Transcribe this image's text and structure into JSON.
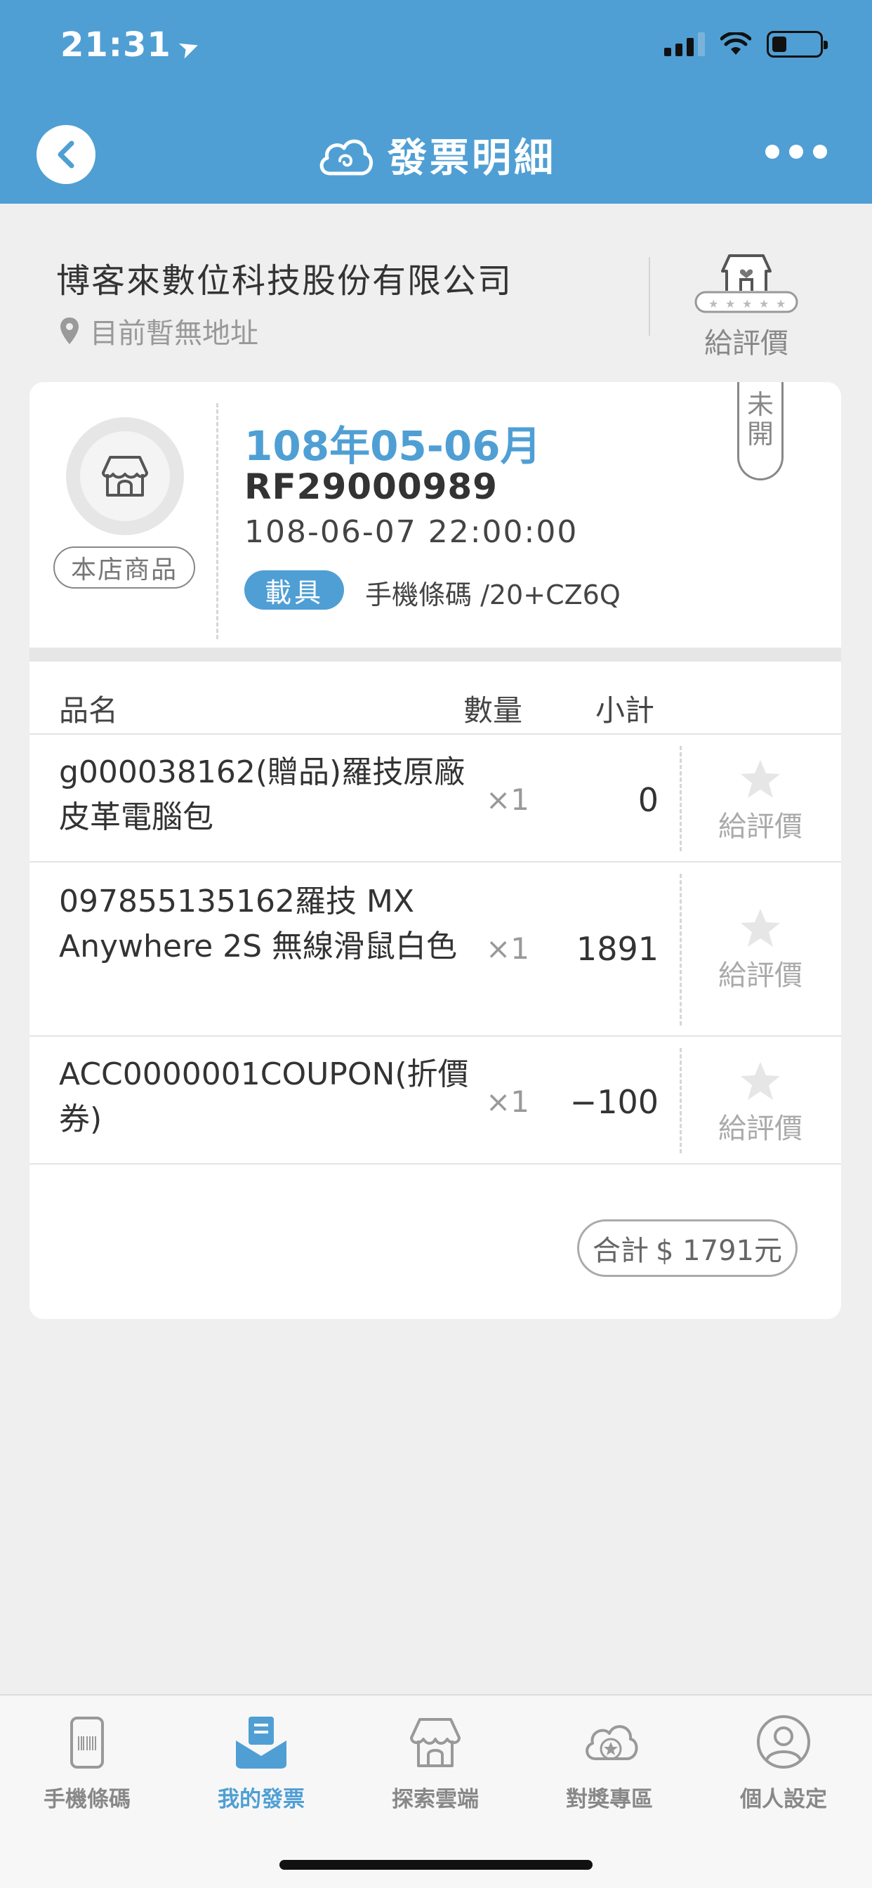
{
  "status_bar": {
    "time": "21:31"
  },
  "header": {
    "title": "發票明細"
  },
  "store": {
    "name": "博客來數位科技股份有限公司",
    "address": "目前暫無地址",
    "rate_label": "給評價"
  },
  "invoice": {
    "store_badge": "本店商品",
    "period": "108年05-06月",
    "number": "RF29000989",
    "datetime": "108-06-07 22:00:00",
    "carrier_tag": "載具",
    "carrier_value": "手機條碼 /20+CZ6Q",
    "status_line1": "未",
    "status_line2": "開"
  },
  "table": {
    "headers": {
      "name": "品名",
      "qty": "數量",
      "subtotal": "小計"
    },
    "rate_label": "給評價",
    "rows": [
      {
        "name": "g000038162(贈品)羅技原廠皮革電腦包",
        "qty": "×1",
        "subtotal": "0"
      },
      {
        "name": "097855135162羅技 MX Anywhere 2S 無線滑鼠白色",
        "qty": "×1",
        "subtotal": "1891"
      },
      {
        "name": "ACC0000001COUPON(折價券)",
        "qty": "×1",
        "subtotal": "−100"
      }
    ],
    "total_label": "合計",
    "total_value": "$ 1791元"
  },
  "tabbar": {
    "items": [
      {
        "label": "手機條碼",
        "icon": "barcode-phone-icon",
        "active": false
      },
      {
        "label": "我的發票",
        "icon": "invoice-inbox-icon",
        "active": true
      },
      {
        "label": "探索雲端",
        "icon": "store-icon",
        "active": false
      },
      {
        "label": "對獎專區",
        "icon": "cloud-star-icon",
        "active": false
      },
      {
        "label": "個人設定",
        "icon": "user-icon",
        "active": false
      }
    ]
  },
  "colors": {
    "primary": "#4f9fd4",
    "background": "#efefef"
  }
}
